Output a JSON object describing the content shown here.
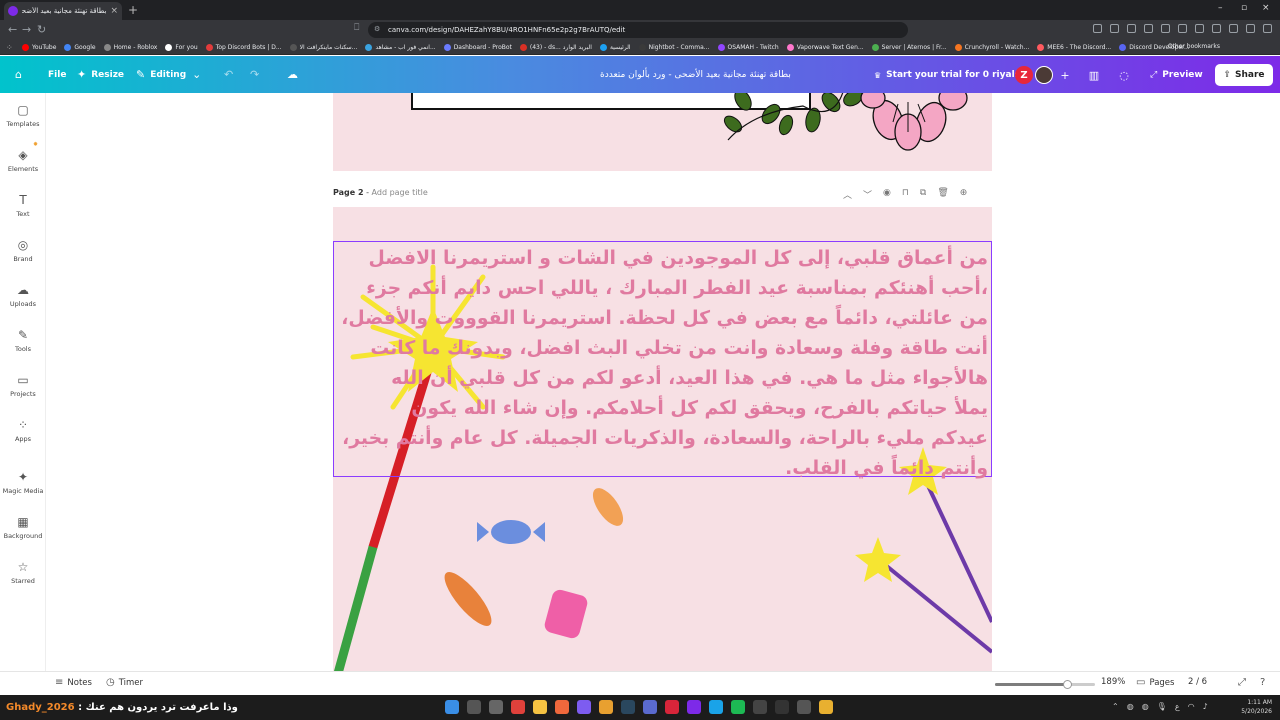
{
  "browser": {
    "tab_title": "بطاقة تهنئة مجانية بعيد الأضحى",
    "url": "canva.com/design/DAHEZahY8BU/4RO1HNFn65e2p2g7BrAUTQ/edit",
    "new_tab": "+",
    "bookmarks": [
      {
        "label": "YouTube",
        "color": "#ff0000"
      },
      {
        "label": "Google",
        "color": "#4285f4"
      },
      {
        "label": "Home - Roblox",
        "color": "#888888"
      },
      {
        "label": "For you",
        "color": "#ffffff"
      },
      {
        "label": "Top Discord Bots | D...",
        "color": "#e23b3b"
      },
      {
        "label": "سكنات ماينكرافت الا...",
        "color": "#555555"
      },
      {
        "label": "انمي فور اب - مشاهد...",
        "color": "#3aa3e0"
      },
      {
        "label": "Dashboard - ProBot",
        "color": "#6b7cff"
      },
      {
        "label": "(43) - ds... البريد الوارد",
        "color": "#d93025"
      },
      {
        "label": "الرئيسية",
        "color": "#1da1f2"
      },
      {
        "label": "Nightbot - Comma...",
        "color": "#3a3a3a"
      },
      {
        "label": "OSAMAH - Twitch",
        "color": "#9146ff"
      },
      {
        "label": "Vaporwave Text Gen...",
        "color": "#ff77cc"
      },
      {
        "label": "Server | Aternos | Fr...",
        "color": "#4caf50"
      },
      {
        "label": "Crunchyroll - Watch...",
        "color": "#f47521"
      },
      {
        "label": "MEE6 - The Discord...",
        "color": "#ff5a5f"
      },
      {
        "label": "Discord Developer...",
        "color": "#5865f2"
      }
    ],
    "other_bookmarks": "Other bookmarks"
  },
  "header": {
    "file": "File",
    "resize": "Resize",
    "editing": "Editing",
    "doc_title": "بطاقة تهنئة مجانية بعيد الأضحى - ورد بألوان متعددة",
    "trial": "Start your trial for 0 riyals",
    "avatar_letter": "Z",
    "preview": "Preview",
    "share": "Share"
  },
  "sidebar": {
    "items": [
      {
        "label": "Templates",
        "icon": "▢"
      },
      {
        "label": "Elements",
        "icon": "◈"
      },
      {
        "label": "Text",
        "icon": "T"
      },
      {
        "label": "Brand",
        "icon": "◎"
      },
      {
        "label": "Uploads",
        "icon": "☁"
      },
      {
        "label": "Tools",
        "icon": "✎"
      },
      {
        "label": "Projects",
        "icon": "▭"
      },
      {
        "label": "Apps",
        "icon": "⁘"
      },
      {
        "label": "Magic Media",
        "icon": "✦"
      },
      {
        "label": "Background",
        "icon": "▦"
      },
      {
        "label": "Starred",
        "icon": "☆"
      }
    ]
  },
  "canvas": {
    "page_label": "Page 2",
    "page_title_placeholder": "Add page title",
    "arabic_lines": [
      "من أعماق قلبي، إلى كل الموجودين في الشات و استريمرنا الافضل",
      "،أحب أهنئكم بمناسبة عيد الفطر المبارك ، ياللي احس دايم أنكم جزء",
      "من عائلتي، دائماً مع بعض في كل لحظة. استريمرنا القوووت والأفضل،",
      "أنت طاقة وفلة وسعادة وانت من تخلي البث افضل، وبدونك ما كانت",
      "هالأجواء مثل ما هي. في هذا العيد، أدعو لكم من كل قلبي أن الله",
      "يملأ حياتكم بالفرح، ويحقق لكم كل أحلامكم. وإن شاء الله يكون",
      "عيدكم مليء بالراحة، والسعادة، والذكريات الجميلة. كل عام وأنتم بخير،",
      "وأنتم دائماً في القلب."
    ],
    "text_color": "#e07aa0",
    "page_bg": "#f7e0e4"
  },
  "bottombar": {
    "notes": "Notes",
    "timer": "Timer",
    "zoom": "189%",
    "zoom_level": 0.72,
    "pages": "Pages",
    "page_count": "2 / 6"
  },
  "taskbar": {
    "user_name": "Ghady_2026",
    "message": ": وذا ماعرفت ترد يردون هم عنك",
    "lang": "ع",
    "time": "1:11 AM",
    "date": "5/20/2026"
  }
}
